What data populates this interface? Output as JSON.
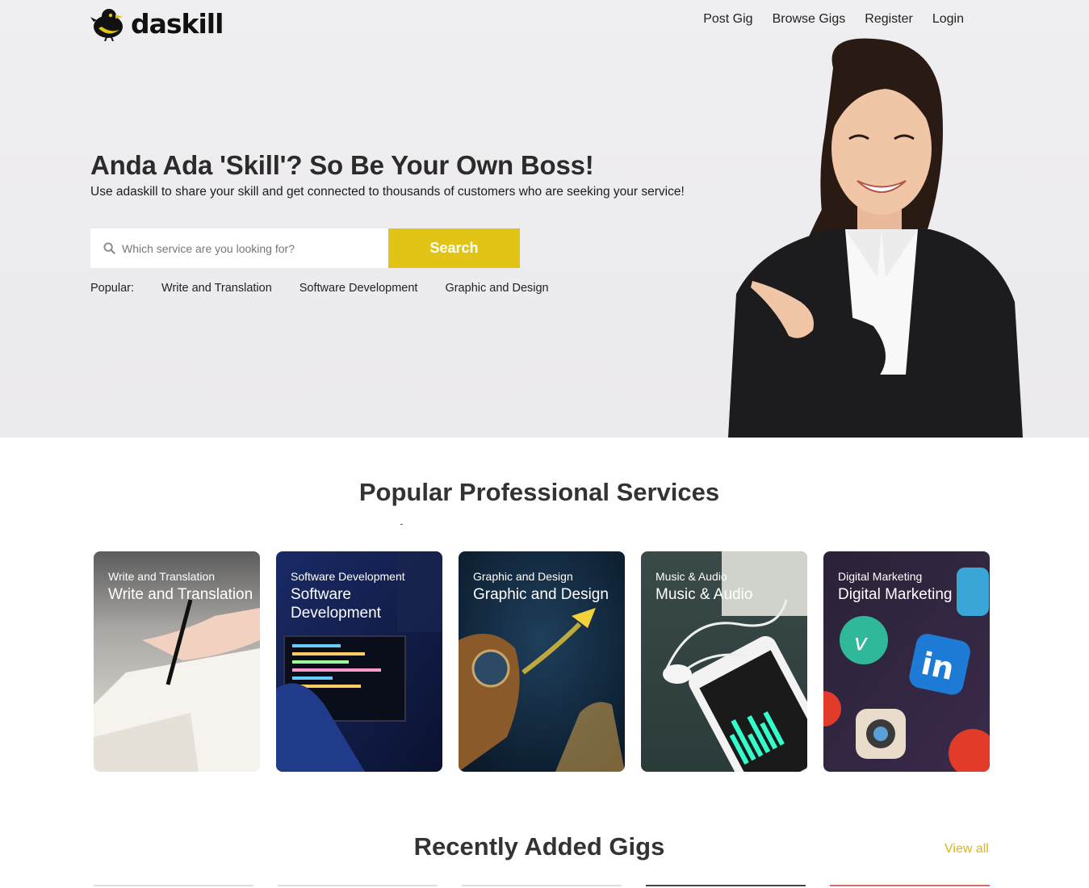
{
  "brand": {
    "logo_text": "daskill"
  },
  "nav": {
    "items": [
      "Post Gig",
      "Browse Gigs",
      "Register",
      "Login"
    ]
  },
  "hero": {
    "title": "Anda Ada 'Skill'? So Be Your Own Boss!",
    "subtitle": "Use adaskill to share your skill and get connected to thousands of customers who are seeking your service!",
    "search_placeholder": "Which service are you looking for?",
    "search_button": "Search",
    "popular_label": "Popular:",
    "popular_tags": [
      "Write and Translation",
      "Software Development",
      "Graphic and Design"
    ]
  },
  "services": {
    "title": "Popular Professional Services",
    "cards": [
      {
        "small": "Write and Translation",
        "big": "Write and Translation"
      },
      {
        "small": "Software Development",
        "big": "Software Development"
      },
      {
        "small": "Graphic and Design",
        "big": "Graphic and Design"
      },
      {
        "small": "Music & Audio",
        "big": "Music & Audio"
      },
      {
        "small": "Digital Marketing",
        "big": "Digital Marketing"
      }
    ]
  },
  "recent": {
    "title": "Recently Added Gigs",
    "view_all": "View all"
  },
  "colors": {
    "accent": "#e2c417",
    "link_accent": "#d9b715"
  }
}
